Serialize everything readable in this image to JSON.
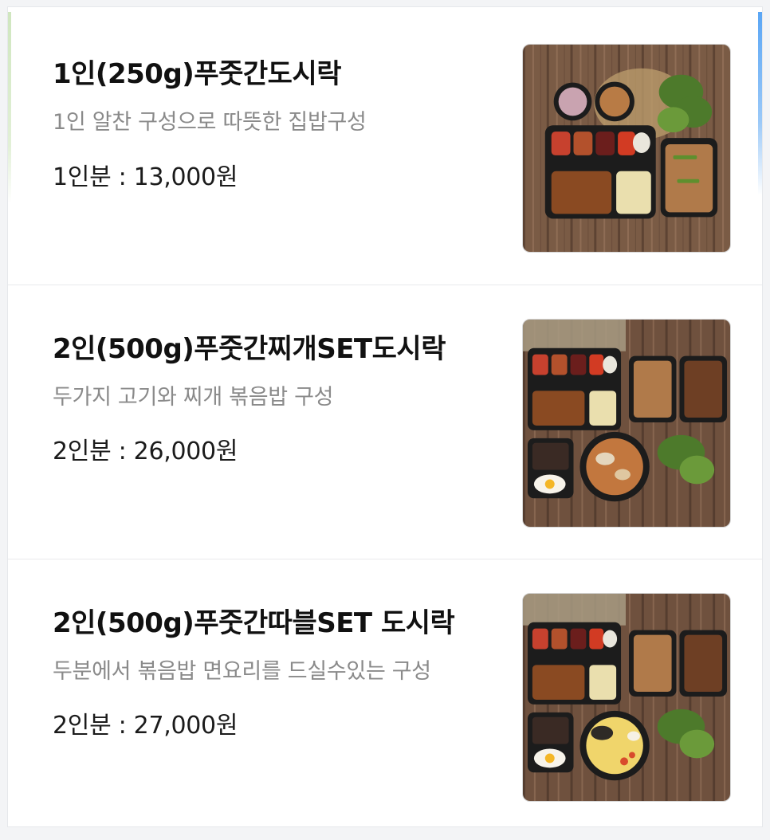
{
  "menu_items": [
    {
      "title": "1인(250g)푸줏간도시락",
      "description": "1인 알찬 구성으로 따뜻한 집밥구성",
      "price": "1인분 : 13,000원",
      "image_icon": "lunchbox-1-person-photo"
    },
    {
      "title": "2인(500g)푸줏간찌개SET도시락",
      "description": "두가지 고기와 찌개 볶음밥 구성",
      "price": "2인분 : 26,000원",
      "image_icon": "lunchbox-stew-set-photo"
    },
    {
      "title": "2인(500g)푸줏간따블SET 도시락",
      "description": "두분에서 볶음밥 면요리를 드실수있는 구성",
      "price": "2인분 : 27,000원",
      "image_icon": "lunchbox-double-set-photo"
    }
  ],
  "colors": {
    "title": "#111111",
    "description": "#8a8a8a",
    "price": "#1b1b1b",
    "divider": "#e9eaec",
    "wood": "#7a5b45",
    "container": "#1c1c1c"
  }
}
